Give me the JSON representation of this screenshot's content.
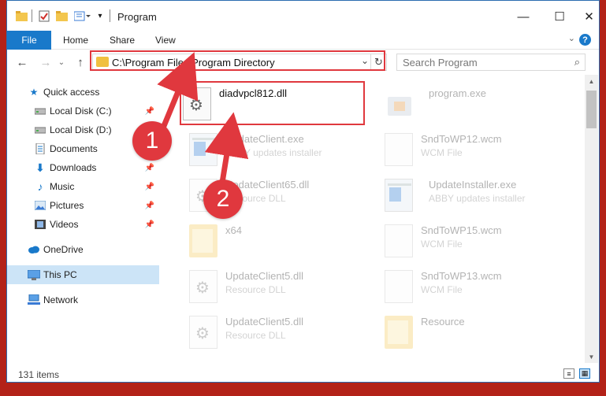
{
  "window": {
    "title": "Program",
    "controls": {
      "minimize": "—",
      "maximize": "☐",
      "close": "✕"
    }
  },
  "ribbon": {
    "tabs": [
      "File",
      "Home",
      "Share",
      "View"
    ],
    "help": "?"
  },
  "nav": {
    "address": "C:\\Program Files\\Program Directory",
    "search_placeholder": "Search Program"
  },
  "sidebar": {
    "items": [
      {
        "label": "Quick access",
        "icon": "star-icon",
        "pinned": false
      },
      {
        "label": "Local Disk (C:)",
        "icon": "drive-icon",
        "pinned": true
      },
      {
        "label": "Local Disk (D:)",
        "icon": "drive-icon",
        "pinned": true
      },
      {
        "label": "Documents",
        "icon": "documents-icon",
        "pinned": true
      },
      {
        "label": "Downloads",
        "icon": "download-icon",
        "pinned": true
      },
      {
        "label": "Music",
        "icon": "music-icon",
        "pinned": true
      },
      {
        "label": "Pictures",
        "icon": "pictures-icon",
        "pinned": true
      },
      {
        "label": "Videos",
        "icon": "videos-icon",
        "pinned": true
      },
      {
        "label": "OneDrive",
        "icon": "cloud-icon",
        "pinned": false
      },
      {
        "label": "This PC",
        "icon": "computer-icon",
        "pinned": false,
        "selected": true
      },
      {
        "label": "Network",
        "icon": "network-icon",
        "pinned": false
      }
    ]
  },
  "files": [
    {
      "name": "diadvpcl812.dll",
      "type": "",
      "icon": "dll-file-icon",
      "faded": false
    },
    {
      "name": "program.exe",
      "type": "",
      "icon": "program-exe-icon",
      "faded": true
    },
    {
      "name": "UpdateClient.exe",
      "type": "ABBY updates installer",
      "icon": "installer-icon",
      "faded": true
    },
    {
      "name": "SndToWP12.wcm",
      "type": "WCM File",
      "icon": "blank-file-icon",
      "faded": true
    },
    {
      "name": "UpdateClient65.dll",
      "type": "Resource DLL",
      "icon": "dll-file-icon",
      "faded": true
    },
    {
      "name": "UpdateInstaller.exe",
      "type": "ABBY updates installer",
      "icon": "installer-icon",
      "faded": true
    },
    {
      "name": "x64",
      "type": "",
      "icon": "folder-icon",
      "faded": true
    },
    {
      "name": "SndToWP15.wcm",
      "type": "WCM File",
      "icon": "blank-file-icon",
      "faded": true
    },
    {
      "name": "UpdateClient5.dll",
      "type": "Resource DLL",
      "icon": "dll-file-icon",
      "faded": true
    },
    {
      "name": "SndToWP13.wcm",
      "type": "WCM File",
      "icon": "blank-file-icon",
      "faded": true
    },
    {
      "name": "UpdateClient5.dll",
      "type": "Resource DLL",
      "icon": "dll-file-icon",
      "faded": true
    },
    {
      "name": "Resource",
      "type": "",
      "icon": "folder-icon",
      "faded": true
    }
  ],
  "status": {
    "item_count": "131 items"
  },
  "annotations": {
    "step1": "1",
    "step2": "2"
  },
  "colors": {
    "accent": "#1979ca",
    "annotation": "#e0383e",
    "selected": "#cce4f7"
  }
}
